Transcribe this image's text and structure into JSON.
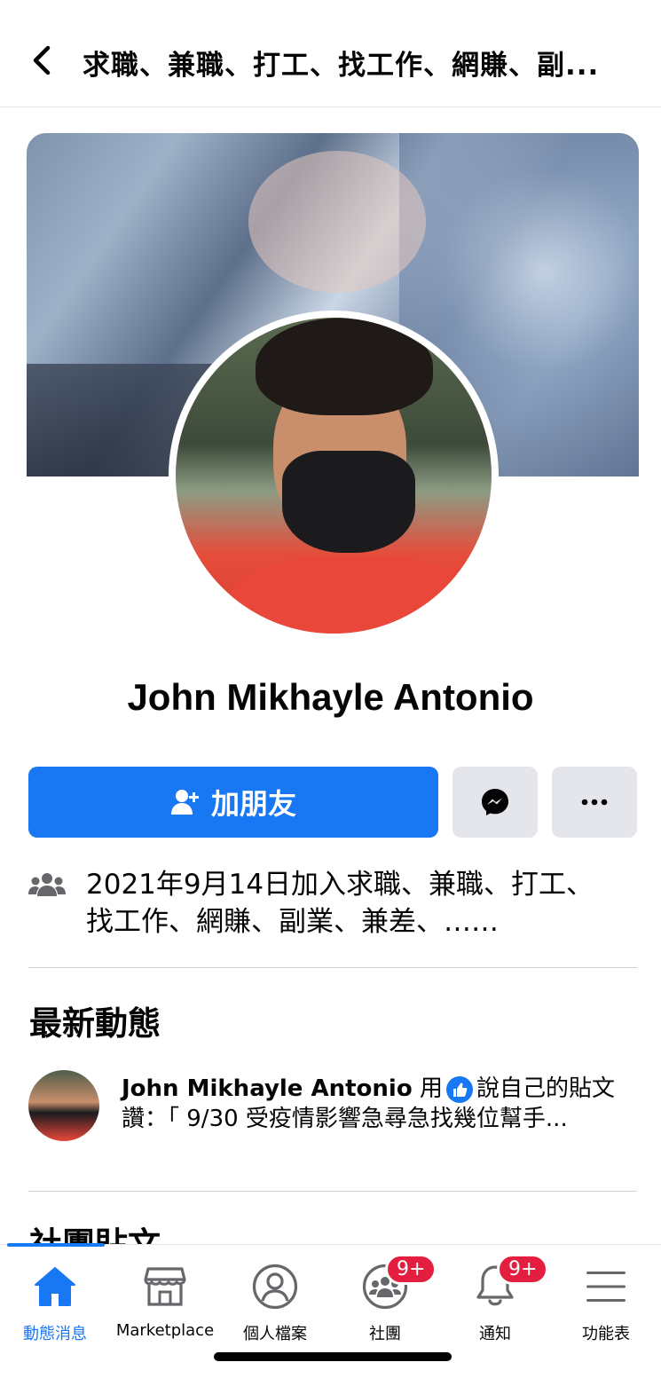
{
  "header": {
    "title": "求職、兼職、打工、找工作、網賺、副..."
  },
  "profile": {
    "name": "John Mikhayle Antonio",
    "add_friend_label": "加朋友",
    "joined_text": "2021年9月14日加入求職、兼職、打工、找工作、網賺、副業、兼差、……"
  },
  "latest": {
    "section_title": "最新動態",
    "activity_name": "John Mikhayle Antonio",
    "activity_mid": "用",
    "activity_after": "說自己的貼文",
    "activity_line2": "讚：「 9/30 受疫情影響急尋急找幾位幫手..."
  },
  "group_posts": {
    "section_title": "社團貼文"
  },
  "tabbar": {
    "items": [
      {
        "label": "動態消息",
        "icon": "home-icon"
      },
      {
        "label": "Marketplace",
        "icon": "marketplace-icon"
      },
      {
        "label": "個人檔案",
        "icon": "profile-icon"
      },
      {
        "label": "社團",
        "icon": "groups-icon",
        "badge": "9+"
      },
      {
        "label": "通知",
        "icon": "bell-icon",
        "badge": "9+"
      },
      {
        "label": "功能表",
        "icon": "menu-icon"
      }
    ]
  },
  "colors": {
    "accent": "#1877f2",
    "badge": "#e41e3f",
    "button_gray": "#e4e6eb"
  }
}
